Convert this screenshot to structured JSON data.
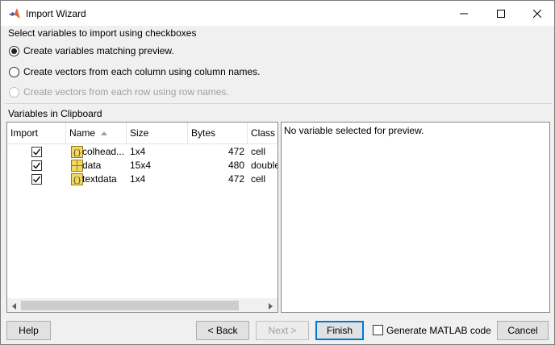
{
  "window": {
    "title": "Import Wizard"
  },
  "options": {
    "heading": "Select variables to import using checkboxes",
    "items": [
      {
        "label": "Create variables matching preview.",
        "checked": true,
        "disabled": false
      },
      {
        "label": "Create vectors from each column using column names.",
        "checked": false,
        "disabled": false
      },
      {
        "label": "Create vectors from each row using row names.",
        "checked": false,
        "disabled": true
      }
    ]
  },
  "variables": {
    "heading": "Variables in Clipboard",
    "columns": [
      "Import",
      "Name",
      "Size",
      "Bytes",
      "Class"
    ],
    "rows": [
      {
        "import": true,
        "icon": "cell-array-icon",
        "name": "colhead...",
        "size": "1x4",
        "bytes": "472",
        "class": "cell"
      },
      {
        "import": true,
        "icon": "matrix-icon",
        "name": "data",
        "size": "15x4",
        "bytes": "480",
        "class": "double"
      },
      {
        "import": true,
        "icon": "cell-array-icon",
        "name": "textdata",
        "size": "1x4",
        "bytes": "472",
        "class": "cell"
      }
    ]
  },
  "preview": {
    "message": "No variable selected for preview."
  },
  "buttons": {
    "help": "Help",
    "back": "< Back",
    "next": "Next >",
    "finish": "Finish",
    "generate_code": "Generate MATLAB code",
    "cancel": "Cancel"
  },
  "colors": {
    "accent": "#0078d7",
    "matlab_orange": "#e16737",
    "cell_icon_yellow": "#f3d75e"
  }
}
